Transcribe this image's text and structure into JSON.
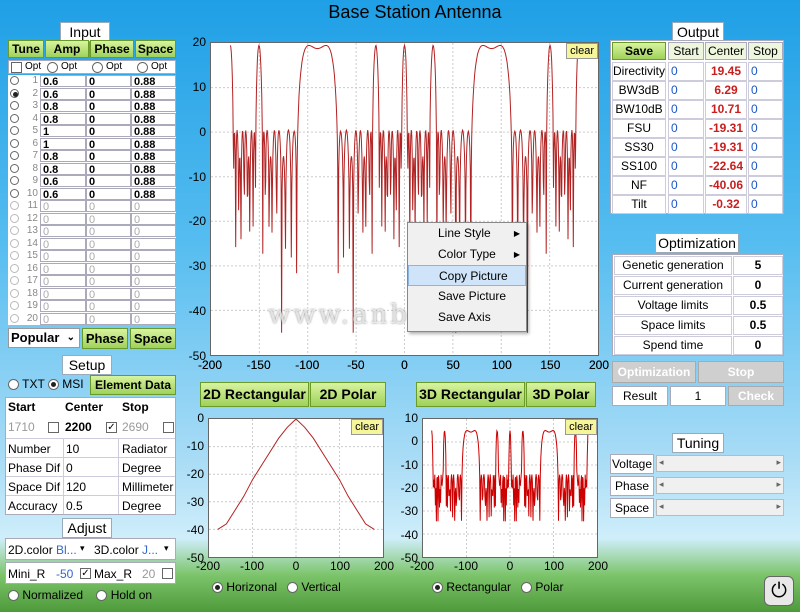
{
  "title": "Base Station Antenna",
  "watermark": "www.anbss.com",
  "input": {
    "title": "Input",
    "headers": [
      "Tune",
      "Amp",
      "Phase",
      "Space"
    ],
    "opt_labels": [
      "Opt",
      "Opt",
      "Opt",
      "Opt"
    ],
    "rows": [
      [
        "1",
        "0.6",
        "0",
        "0.88"
      ],
      [
        "2",
        "0.6",
        "0",
        "0.88"
      ],
      [
        "3",
        "0.8",
        "0",
        "0.88"
      ],
      [
        "4",
        "0.8",
        "0",
        "0.88"
      ],
      [
        "5",
        "1",
        "0",
        "0.88"
      ],
      [
        "6",
        "1",
        "0",
        "0.88"
      ],
      [
        "7",
        "0.8",
        "0",
        "0.88"
      ],
      [
        "8",
        "0.8",
        "0",
        "0.88"
      ],
      [
        "9",
        "0.6",
        "0",
        "0.88"
      ],
      [
        "10",
        "0.6",
        "0",
        "0.88"
      ],
      [
        "11",
        "0",
        "0",
        "0"
      ],
      [
        "12",
        "0",
        "0",
        "0"
      ],
      [
        "13",
        "0",
        "0",
        "0"
      ],
      [
        "14",
        "0",
        "0",
        "0"
      ],
      [
        "15",
        "0",
        "0",
        "0"
      ],
      [
        "16",
        "0",
        "0",
        "0"
      ],
      [
        "17",
        "0",
        "0",
        "0"
      ],
      [
        "18",
        "0",
        "0",
        "0"
      ],
      [
        "19",
        "0",
        "0",
        "0"
      ],
      [
        "20",
        "0",
        "0",
        "0"
      ]
    ],
    "dropdown": "Popular",
    "phase_btn": "Phase",
    "space_btn": "Space"
  },
  "setup": {
    "title": "Setup",
    "radio_txt": "TXT",
    "radio_msi": "MSI",
    "element_btn": "Element Data",
    "headers": [
      "Start",
      "Center",
      "Stop"
    ],
    "start": "1710",
    "center": "2200",
    "stop": "2690",
    "rows": [
      [
        "Number",
        "10",
        "Radiator"
      ],
      [
        "Phase Dif",
        "0",
        "Degree"
      ],
      [
        "Space Dif",
        "120",
        "Millimeter"
      ],
      [
        "Accuracy",
        "0.5",
        "Degree"
      ]
    ]
  },
  "adjust": {
    "title": "Adjust",
    "color2d_label": "2D.color",
    "color2d": "Bl...",
    "color3d_label": "3D.color",
    "color3d": "J...",
    "mini_label": "Mini_R",
    "mini": "-50",
    "max_label": "Max_R",
    "max": "20",
    "normalized": "Normalized",
    "hold": "Hold on"
  },
  "output": {
    "title": "Output",
    "headers": [
      "Save",
      "Start",
      "Center",
      "Stop"
    ],
    "rows": [
      [
        "Directivity",
        "0",
        "19.45",
        "0"
      ],
      [
        "BW3dB",
        "0",
        "6.29",
        "0"
      ],
      [
        "BW10dB",
        "0",
        "10.71",
        "0"
      ],
      [
        "FSU",
        "0",
        "-19.31",
        "0"
      ],
      [
        "SS30",
        "0",
        "-19.31",
        "0"
      ],
      [
        "SS100",
        "0",
        "-22.64",
        "0"
      ],
      [
        "NF",
        "0",
        "-40.06",
        "0"
      ],
      [
        "Tilt",
        "0",
        "-0.32",
        "0"
      ]
    ]
  },
  "optimization": {
    "title": "Optimization",
    "rows": [
      [
        "Genetic generation",
        "5"
      ],
      [
        "Current generation",
        "0"
      ],
      [
        "Voltage limits",
        "0.5"
      ],
      [
        "Space limits",
        "0.5"
      ],
      [
        "Spend time",
        "0"
      ]
    ],
    "opt_btn": "Optimization",
    "stop_btn": "Stop",
    "result_label": "Result",
    "result": "1",
    "check_btn": "Check"
  },
  "tuning": {
    "title": "Tuning",
    "rows": [
      "Voltage",
      "Phase",
      "Space"
    ]
  },
  "buttons": {
    "rect2d": "2D Rectangular",
    "polar2d": "2D Polar",
    "rect3d": "3D Rectangular",
    "polar3d": "3D Polar",
    "clear": "clear"
  },
  "radios": {
    "horizontal": "Horizonal",
    "vertical": "Vertical",
    "rectangular": "Rectangular",
    "polar": "Polar"
  },
  "context_menu": [
    "Line Style",
    "Color Type",
    "Copy Picture",
    "Save Picture",
    "Save Axis"
  ],
  "chart_data": [
    {
      "type": "line",
      "xlim": [
        -200,
        200
      ],
      "ylim": [
        -50,
        20
      ],
      "xticks": [
        "-200",
        "-150",
        "-100",
        "-50",
        "0",
        "50",
        "100",
        "150",
        "200"
      ],
      "yticks": [
        "20",
        "10",
        "0",
        "-10",
        "-20",
        "-30",
        "-40",
        "-50"
      ],
      "grid": true,
      "color": "#b22222"
    },
    {
      "type": "line",
      "xlim": [
        -200,
        200
      ],
      "ylim": [
        -50,
        0
      ],
      "xticks": [
        "-200",
        "-100",
        "0",
        "100",
        "200"
      ],
      "yticks": [
        "0",
        "-10",
        "-20",
        "-30",
        "-40",
        "-50"
      ],
      "grid": true,
      "color": "#b22222",
      "x": [
        -180,
        -160,
        -140,
        -120,
        -100,
        -80,
        -60,
        -40,
        -20,
        0,
        20,
        40,
        60,
        80,
        100,
        120,
        140,
        160,
        180
      ],
      "y": [
        -40,
        -38,
        -33,
        -28,
        -22,
        -17,
        -12,
        -7,
        -3,
        0,
        -3,
        -7,
        -12,
        -17,
        -22,
        -28,
        -33,
        -38,
        -40
      ]
    },
    {
      "type": "line",
      "xlim": [
        -200,
        200
      ],
      "ylim": [
        -50,
        10
      ],
      "xticks": [
        "-200",
        "-100",
        "0",
        "100",
        "200"
      ],
      "yticks": [
        "10",
        "0",
        "-10",
        "-20",
        "-30",
        "-40",
        "-50"
      ],
      "grid": true,
      "color": "#cc0000"
    }
  ]
}
